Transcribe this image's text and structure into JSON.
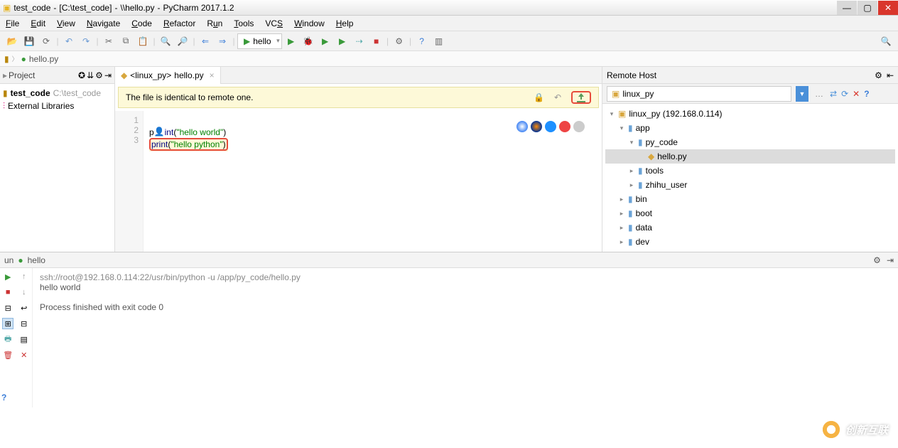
{
  "title": {
    "project": "test_code",
    "path": "[C:\\test_code]",
    "file": "\\\\hello.py",
    "app": "PyCharm 2017.1.2"
  },
  "menu": [
    "File",
    "Edit",
    "View",
    "Navigate",
    "Code",
    "Refactor",
    "Run",
    "Tools",
    "VCS",
    "Window",
    "Help"
  ],
  "runcfg": "hello",
  "breadcrumb": {
    "file": "hello.py"
  },
  "project_panel": {
    "title": "Project",
    "root": "test_code",
    "root_path": "C:\\test_code",
    "ext": "External Libraries"
  },
  "editor": {
    "tab_prefix": "<linux_py>",
    "tab_file": "hello.py",
    "notice": "The file is identical to remote one.",
    "lines": {
      "l1": "",
      "l2a": "p",
      "l2b": "int",
      "l2s": "\"hello world\"",
      "l3a": "print",
      "l3s": "\"hello python\""
    }
  },
  "remote": {
    "title": "Remote Host",
    "combo": "linux_py",
    "tree": {
      "root": "linux_py (192.168.0.114)",
      "app": "app",
      "py_code": "py_code",
      "hello": "hello.py",
      "tools": "tools",
      "zhihu": "zhihu_user",
      "bin": "bin",
      "boot": "boot",
      "data": "data",
      "dev": "dev"
    }
  },
  "run": {
    "tab_label": "hello",
    "prefix": "un",
    "cmd": "ssh://root@192.168.0.114:22/usr/bin/python -u /app/py_code/hello.py",
    "out": "hello world",
    "exit": "Process finished with exit code 0"
  },
  "watermark": "创新互联"
}
